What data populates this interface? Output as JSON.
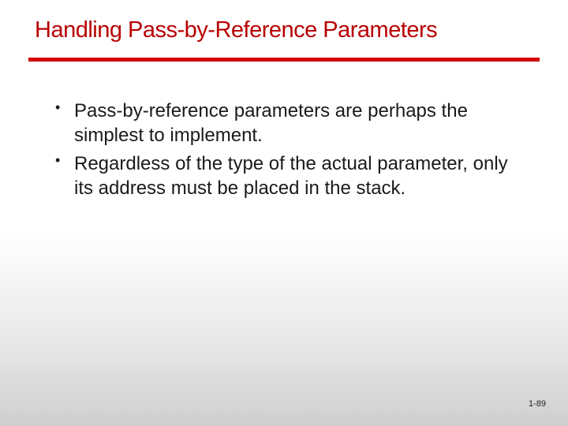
{
  "title": "Handling Pass-by-Reference Parameters",
  "bullets": [
    "Pass-by-reference parameters are perhaps the simplest to implement.",
    "Regardless of the type of the actual parameter, only its address must be placed in the stack."
  ],
  "page_number": "1-89"
}
